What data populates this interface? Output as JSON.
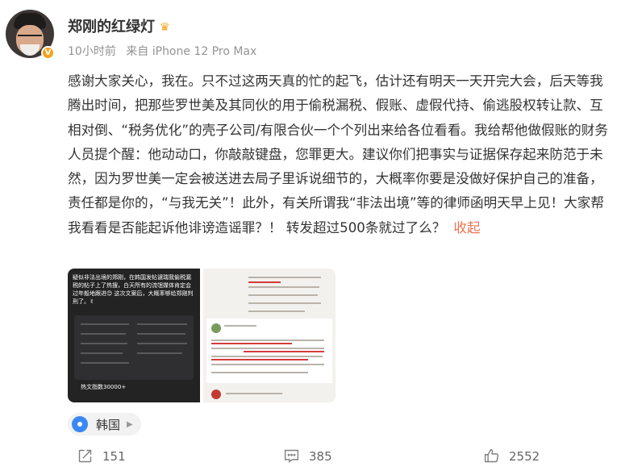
{
  "author": {
    "name": "郑刚的红绿灯",
    "verified_badge": "V"
  },
  "meta": {
    "time": "10小时前",
    "source": "来自 iPhone 12 Pro Max"
  },
  "post": {
    "text": "感谢大家关心，我在。只不过这两天真的忙的起飞，估计还有明天一天开完大会，后天等我腾出时间，把那些罗世美及其同伙的用于偷税漏税、假账、虚假代持、偷逃股权转让款、互相对倒、“税务优化”的壳子公司/有限合伙一个个列出来给各位看看。我给帮他做假账的财务人员提个醒：他动动口，你敲敲键盘，您罪更大。建议你们把事实与证据保存起来防范于未然，因为罗世美一定会被送进去局子里诉说细节的，大概率你要是没做好保护自己的准备，责任都是你的，“与我无关”！此外，有关所谓我“非法出境”等的律师函明天早上见！大家帮我看看是否能起诉他诽谤造谣罪？！ 转发超过500条就过了么？",
    "collapse_label": "收起"
  },
  "images": {
    "first_caption": "疑似非法出境的郑刚，在韩国发帖谴瑞我偷税漏税的帖子上了热搜，白天所有的流氓媒体肯定会过年般地跟进😊 这次文案后，大概率够给郑刚判刑了。✌",
    "first_footer": "热文指数30000+"
  },
  "location": {
    "label": "韩国",
    "icon": "location-pin-icon"
  },
  "actions": {
    "repost_count": "151",
    "comment_count": "385",
    "like_count": "2552"
  },
  "colors": {
    "link": "#eb7350",
    "location_icon": "#3a88f4",
    "badge": "#f6a11a"
  }
}
